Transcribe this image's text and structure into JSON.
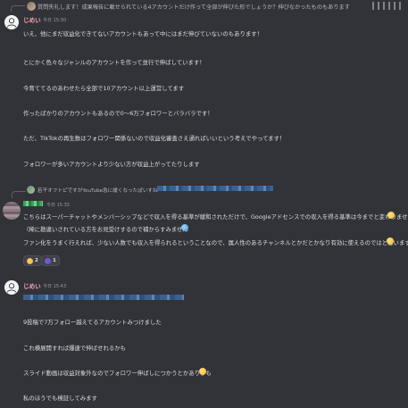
{
  "top_reply": {
    "text": "質問失礼します！成果報告に載せられている4アカウントだけ作って全部が伸びた形でしょうか？伸びなかったものもあります"
  },
  "msg1": {
    "author": "じめい",
    "timestamp": "今日 15:30",
    "lines": [
      "いえ、他にまだ収益化できてないアカウントもあって中にはまだ伸びていないのもあります！",
      "とにかく色々なジャンルのアカウントを作って並行で伸ばしています！",
      "今育ててるのあわせたら全部で10アカウント以上運営してます",
      "作ったばかりのアカウントもあるので0〜6万フォロワーとバラバラです！",
      "ただ、TikTokの再生数はフォロワー関係ないので収益化審査さえ通ればいいという考えでやってます！",
      "フォロワーが多いアカウントより少ない方が収益上がってたりします"
    ]
  },
  "reply2": {
    "text": "若干オフトピですがYouTube急に緩くなったぽいすね"
  },
  "msg2": {
    "timestamp": "今日 15:35",
    "lines": [
      "こちらはスーパーチャットやメンバーシップなどで収入を得る基準が緩和されただけで、Googleアドセンスでの収入を得る基準は今までと変わりません",
      "（稀に勘違いされている方をお見受けするので補からすみません",
      "ファン化をうまく行えれば、少ない人数でも収入を得られるということなので、属人性のあるチャンネルとかだとかなり有効に使えるのではと思います"
    ],
    "reactions": [
      {
        "emoji": "face-icon",
        "count": "2"
      },
      {
        "emoji": "plus-icon",
        "count": "1"
      }
    ]
  },
  "msg3": {
    "author": "じめい",
    "timestamp": "今日 15:43",
    "lines": [
      "9投稿で7万フォロー越えてるアカウントみつけました",
      "これ横展開すれば爆速で伸ばせれるかも",
      "スライド動画は収益対象外なのでフォロワー伸ばしにつかうとかありかも",
      "私のほうでも検証してみます"
    ]
  }
}
